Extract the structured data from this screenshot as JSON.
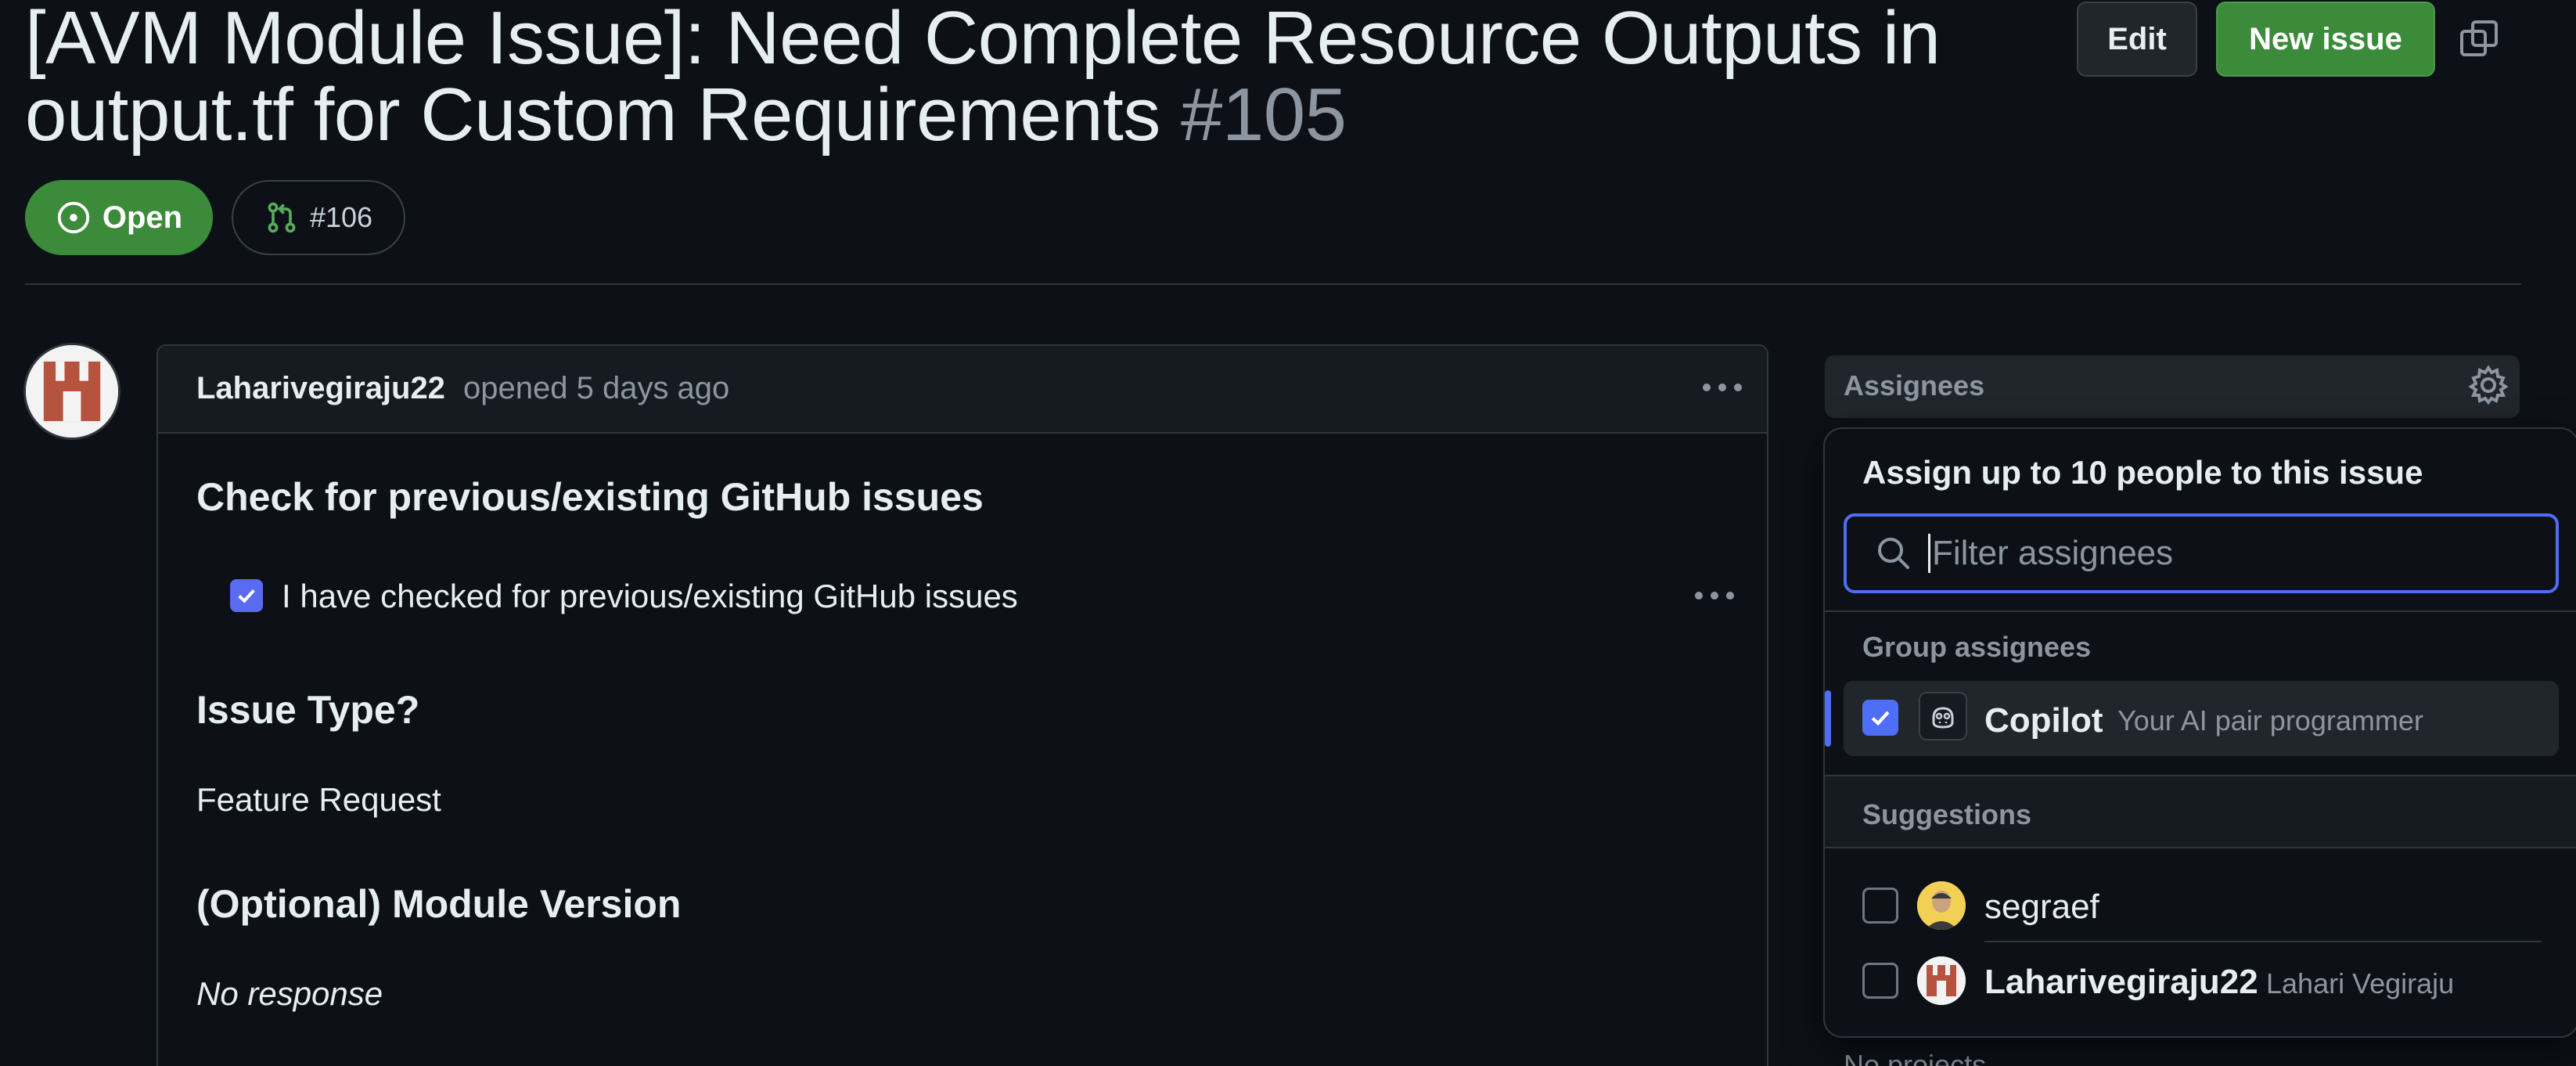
{
  "issue": {
    "title": "[AVM Module Issue]: Need Complete Resource Outputs in output.tf for Custom Requirements",
    "number": "#105",
    "state": "Open",
    "linked_pr": "#106"
  },
  "header_actions": {
    "edit_label": "Edit",
    "new_issue_label": "New issue"
  },
  "comment": {
    "author": "Laharivegiraju22",
    "meta": "opened 5 days ago",
    "sections": {
      "check_heading": "Check for previous/existing GitHub issues",
      "check_item": "I have checked for previous/existing GitHub issues",
      "type_heading": "Issue Type?",
      "type_value": "Feature Request",
      "version_heading": "(Optional) Module Version",
      "version_value": "No response"
    }
  },
  "sidebar": {
    "assignees_label": "Assignees",
    "behind_text": "No projects",
    "popover": {
      "title": "Assign up to 10 people to this issue",
      "filter_placeholder": "Filter assignees",
      "group_label": "Group assignees",
      "suggestions_label": "Suggestions",
      "group": [
        {
          "name": "Copilot",
          "desc": "Your AI pair programmer",
          "checked": true
        }
      ],
      "suggestions": [
        {
          "login": "segraef",
          "name": "",
          "checked": false
        },
        {
          "login": "Laharivegiraju22",
          "name": "Lahari Vegiraju",
          "checked": false
        }
      ]
    }
  },
  "colors": {
    "background": "#0d1117",
    "open_green": "#3c8b3b",
    "accent_blue": "#4f6ef7",
    "muted_text": "#8d96a0",
    "border": "#30363d"
  },
  "icons": [
    "copy-icon",
    "issue-open-icon",
    "git-pull-request-icon",
    "kebab-icon",
    "gear-icon",
    "search-icon",
    "check-icon",
    "copilot-icon"
  ]
}
